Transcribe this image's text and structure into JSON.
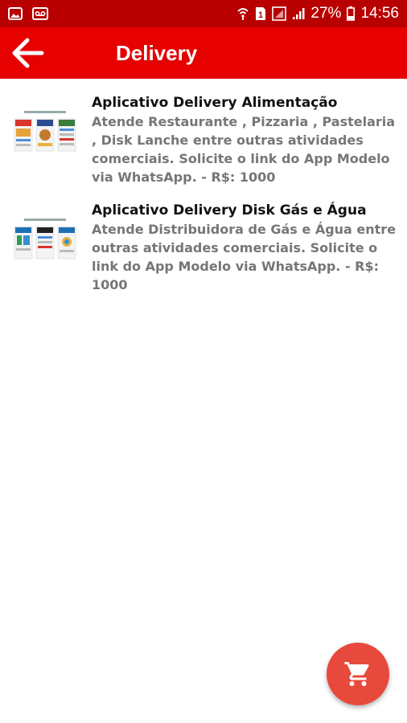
{
  "status_bar": {
    "battery_percent": "27%",
    "time": "14:56",
    "sim_badge": "1",
    "icons": [
      "image-icon",
      "voicemail-icon",
      "wifi-icon",
      "sim-icon",
      "signal-icon",
      "battery-icon"
    ]
  },
  "app_bar": {
    "title": "Delivery",
    "back_icon": "arrow-left-icon"
  },
  "items": [
    {
      "title": "Aplicativo Delivery Alimentação",
      "description": "Atende Restaurante , Pizzaria , Pastelaria , Disk Lanche entre outras atividades comerciais. Solicite o link do App Modelo via WhatsApp. - R$: 1000"
    },
    {
      "title": "Aplicativo Delivery Disk Gás e Água",
      "description": "Atende Distribuidora de Gás e Água entre outras atividades comerciais. Solicite o link do App Modelo via WhatsApp. - R$: 1000"
    }
  ],
  "fab": {
    "icon": "cart-icon"
  },
  "colors": {
    "status_bar": "#b80000",
    "app_bar": "#e60000",
    "fab": "#e8493d",
    "title_text": "#111111",
    "description_text": "#767676"
  }
}
